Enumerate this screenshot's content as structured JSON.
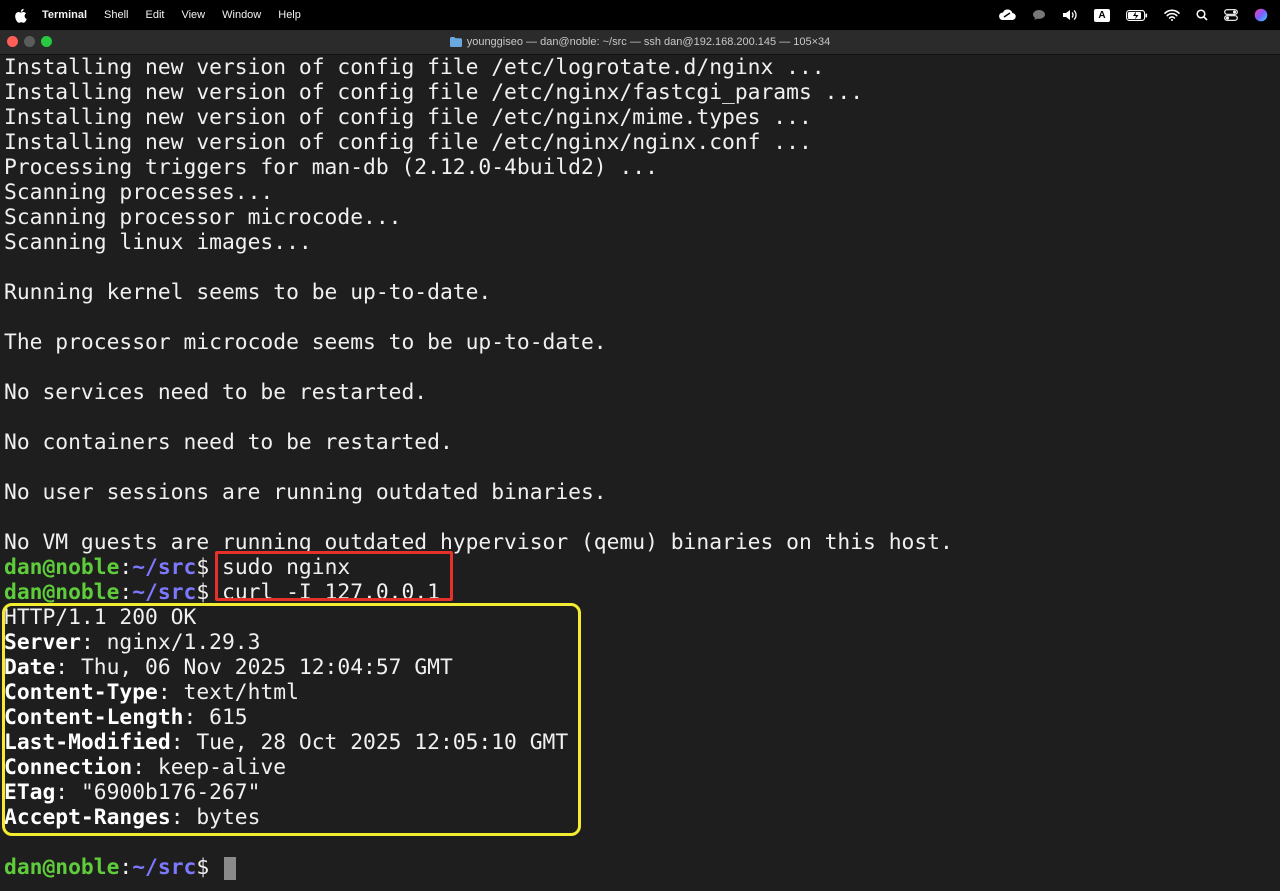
{
  "menubar": {
    "app_name": "Terminal",
    "items": [
      "Shell",
      "Edit",
      "View",
      "Window",
      "Help"
    ],
    "input_source": "A"
  },
  "window": {
    "title": "younggiseo — dan@noble: ~/src — ssh dan@192.168.200.145 — 105×34"
  },
  "terminal": {
    "output_lines": [
      "Installing new version of config file /etc/logrotate.d/nginx ...",
      "Installing new version of config file /etc/nginx/fastcgi_params ...",
      "Installing new version of config file /etc/nginx/mime.types ...",
      "Installing new version of config file /etc/nginx/nginx.conf ...",
      "Processing triggers for man-db (2.12.0-4build2) ...",
      "Scanning processes...",
      "Scanning processor microcode...",
      "Scanning linux images...",
      "",
      "Running kernel seems to be up-to-date.",
      "",
      "The processor microcode seems to be up-to-date.",
      "",
      "No services need to be restarted.",
      "",
      "No containers need to be restarted.",
      "",
      "No user sessions are running outdated binaries.",
      "",
      "No VM guests are running outdated hypervisor (qemu) binaries on this host."
    ],
    "prompt": {
      "user_host": "dan@noble",
      "colon": ":",
      "path": "~/src",
      "dollar": "$ "
    },
    "commands": [
      "sudo nginx",
      "curl -I 127.0.0.1"
    ],
    "status_line": "HTTP/1.1 200 OK",
    "headers": [
      {
        "key": "Server",
        "value": " nginx/1.29.3"
      },
      {
        "key": "Date",
        "value": " Thu, 06 Nov 2025 12:04:57 GMT"
      },
      {
        "key": "Content-Type",
        "value": " text/html"
      },
      {
        "key": "Content-Length",
        "value": " 615"
      },
      {
        "key": "Last-Modified",
        "value": " Tue, 28 Oct 2025 12:05:10 GMT"
      },
      {
        "key": "Connection",
        "value": " keep-alive"
      },
      {
        "key": "ETag",
        "value": " \"6900b176-267\""
      },
      {
        "key": "Accept-Ranges",
        "value": " bytes"
      }
    ],
    "header_separator": ":"
  },
  "colors": {
    "prompt_user": "#5fcd3b",
    "prompt_path": "#7d79ff",
    "annotation_red": "#e8302a",
    "annotation_yellow": "#f4ec30"
  }
}
